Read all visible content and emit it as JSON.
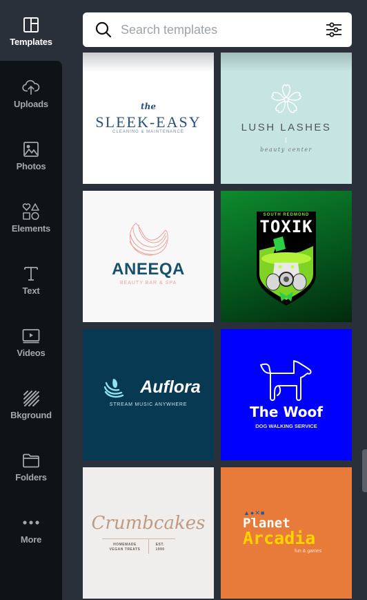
{
  "sidebar": {
    "items": [
      {
        "label": "Templates",
        "icon": "templates-icon",
        "active": true
      },
      {
        "label": "Uploads",
        "icon": "upload-cloud-icon"
      },
      {
        "label": "Photos",
        "icon": "photo-icon"
      },
      {
        "label": "Elements",
        "icon": "shapes-icon"
      },
      {
        "label": "Text",
        "icon": "text-icon"
      },
      {
        "label": "Videos",
        "icon": "video-icon"
      },
      {
        "label": "Bkground",
        "icon": "background-stripes-icon"
      },
      {
        "label": "Folders",
        "icon": "folder-icon"
      },
      {
        "label": "More",
        "icon": "more-dots-icon"
      }
    ]
  },
  "search": {
    "placeholder": "Search templates",
    "value": ""
  },
  "templates": [
    {
      "pre": "the",
      "title": "SLEEK-EASY",
      "sub": "CLEANING & MAINTENANCE",
      "bg": "#ffffff",
      "color": "#2b4f7a"
    },
    {
      "title": "LUSH LASHES",
      "sub": "beauty center",
      "bg": "#c6e5e2",
      "color": "#4d5558"
    },
    {
      "title": "ANEEQA",
      "sub": "BEAUTY BAR & SPA",
      "bg": "#f8f8f8",
      "color": "#17506d",
      "accent": "#e7a29a"
    },
    {
      "pre": "SOUTH REDMOND",
      "title": "TOXIK",
      "bg": "#0e8a2e",
      "accent": "#8fe026"
    },
    {
      "title": "Auflora",
      "sub": "STREAM MUSIC ANYWHERE",
      "bg": "#073a52",
      "accent": "#8fe2ef"
    },
    {
      "title": "The Woof",
      "sub": "DOG WALKING SERVICE",
      "bg": "#0000fe"
    },
    {
      "title": "Crumbcakes",
      "sub_left": "HOMEMADE\nVEGAN TREATS",
      "sub_right": "EST.\n1990",
      "bg": "#efeeec",
      "color": "#c09a80"
    },
    {
      "symbols": "▲●✕■",
      "title_line1": "Planet",
      "title_line2": "Arcadia",
      "sub": "fun & games",
      "bg": "#e87b3a",
      "accent": "#ffd200"
    }
  ]
}
